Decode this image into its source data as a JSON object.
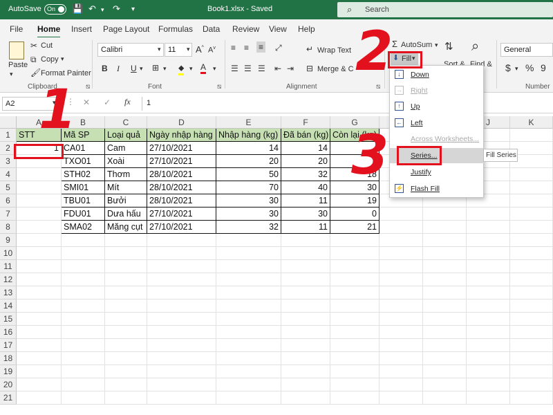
{
  "titlebar": {
    "autosave_label": "AutoSave",
    "autosave_state": "On",
    "document_title": "Book1.xlsx  -  Saved",
    "search_placeholder": "Search"
  },
  "menu": {
    "tabs": [
      "File",
      "Home",
      "Insert",
      "Page Layout",
      "Formulas",
      "Data",
      "Review",
      "View",
      "Help"
    ],
    "active": "Home"
  },
  "ribbon": {
    "clipboard": {
      "paste": "Paste",
      "cut": "Cut",
      "copy": "Copy",
      "format_painter": "Format Painter",
      "group_label": "Clipboard"
    },
    "font": {
      "name": "Calibri",
      "size": "11",
      "group_label": "Font"
    },
    "alignment": {
      "wrap_text": "Wrap Text",
      "merge_center": "Merge & C",
      "group_label": "Alignment"
    },
    "editing": {
      "autosum": "AutoSum",
      "fill": "Fill",
      "sort": "Sort &",
      "find": "Find &"
    },
    "number": {
      "format": "General",
      "group_label": "Number"
    }
  },
  "formula_bar": {
    "name_box": "A2",
    "formula": "1"
  },
  "grid": {
    "columns": [
      "A",
      "B",
      "C",
      "D",
      "E",
      "F",
      "G",
      "H",
      "I",
      "J",
      "K"
    ],
    "row_numbers": [
      "1",
      "2",
      "3",
      "4",
      "5",
      "6",
      "7",
      "8",
      "9",
      "10",
      "11",
      "12",
      "13",
      "14",
      "15",
      "16",
      "17",
      "18",
      "19",
      "20",
      "21"
    ],
    "header": [
      "STT",
      "Mã SP",
      "Loại quả",
      "Ngày nhập hàng",
      "Nhập hàng (kg)",
      "Đã bán (kg)",
      "Còn lại (kg)"
    ],
    "rows": [
      [
        "1",
        "CA01",
        "Cam",
        "27/10/2021",
        "14",
        "14",
        ""
      ],
      [
        "",
        "TXO01",
        "Xoài",
        "27/10/2021",
        "20",
        "20",
        ""
      ],
      [
        "",
        "STH02",
        "Thơm",
        "28/10/2021",
        "50",
        "32",
        "18"
      ],
      [
        "",
        "SMI01",
        "Mít",
        "28/10/2021",
        "70",
        "40",
        "30"
      ],
      [
        "",
        "TBU01",
        "Bưởi",
        "28/10/2021",
        "30",
        "11",
        "19"
      ],
      [
        "",
        "FDU01",
        "Dưa hấu",
        "27/10/2021",
        "30",
        "30",
        "0"
      ],
      [
        "",
        "SMA02",
        "Măng cụt",
        "27/10/2021",
        "32",
        "11",
        "21"
      ]
    ]
  },
  "fill_menu": {
    "items": [
      {
        "label": "Down",
        "icon": "arrow-down-icon",
        "enabled": true
      },
      {
        "label": "Right",
        "icon": "arrow-right-icon",
        "enabled": false
      },
      {
        "label": "Up",
        "icon": "arrow-up-icon",
        "enabled": true
      },
      {
        "label": "Left",
        "icon": "arrow-left-icon",
        "enabled": true
      },
      {
        "label": "Across Worksheets...",
        "icon": "",
        "enabled": false
      },
      {
        "label": "Series...",
        "icon": "",
        "enabled": true,
        "highlighted": true
      },
      {
        "label": "Justify",
        "icon": "",
        "enabled": true
      },
      {
        "label": "Flash Fill",
        "icon": "flash-fill-icon",
        "enabled": true
      }
    ],
    "tooltip": "Fill Series"
  },
  "annotations": {
    "step1": "1",
    "step2": "2",
    "step3": "3",
    "color": "#e3101e"
  },
  "colors": {
    "excel_green": "#217346",
    "header_fill": "#c6e0b4"
  }
}
